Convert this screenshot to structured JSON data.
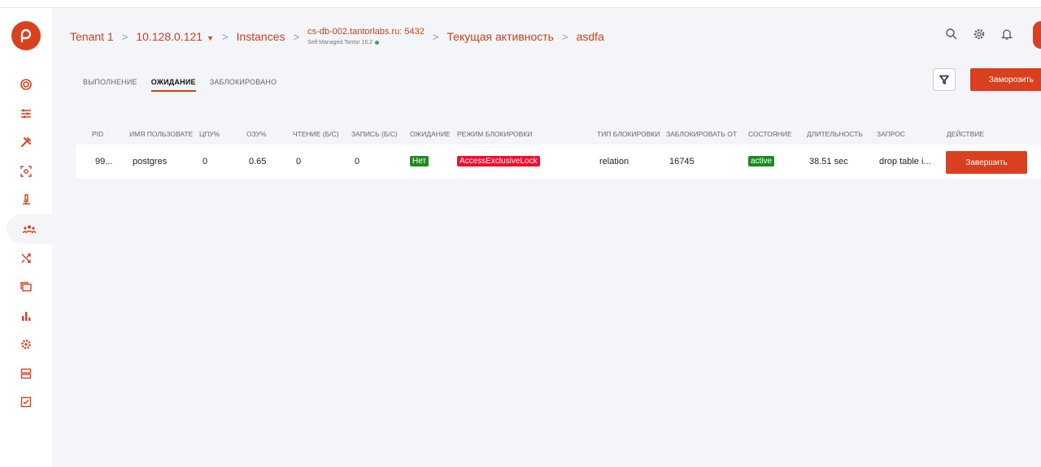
{
  "colors": {
    "accent": "#d9401f",
    "success": "#1e8a1e",
    "danger": "#f20d2a"
  },
  "breadcrumbs": {
    "tenant": "Tenant 1",
    "host": "10.128.0.121",
    "instances": "Instances",
    "db": "cs-db-002.tantorlabs.ru: 5432",
    "db_sub": "Self Managed Tantor 16.2",
    "activity": "Текущая активность",
    "current": "asdfa"
  },
  "header_icons": [
    "search-icon",
    "gear-icon",
    "bell-icon"
  ],
  "sidebar_icons": [
    "target-icon",
    "sliders-icon",
    "tools-icon",
    "scan-icon",
    "microscope-icon",
    "users-icon",
    "shuffle-icon",
    "folders-icon",
    "bar-chart-icon",
    "cog-icon",
    "server-icon",
    "checklist-icon"
  ],
  "tabs": [
    {
      "label": "ВЫПОЛНЕНИЕ",
      "active": false
    },
    {
      "label": "ОЖИДАНИЕ",
      "active": true
    },
    {
      "label": "ЗАБЛОКИРОВАНО",
      "active": false
    }
  ],
  "freeze_label": "Заморозить",
  "table": {
    "headers": [
      "PID",
      "ИМЯ ПОЛЬЗОВАТЕЛЯ",
      "ЦПУ%",
      "ОЗУ%",
      "ЧТЕНИЕ (Б/С)",
      "ЗАПИСЬ (Б/С)",
      "ОЖИДАНИЕ",
      "РЕЖИМ БЛОКИРОВКИ",
      "ТИП БЛОКИРОВКИ",
      "ЗАБЛОКИРОВАТЬ ОТ",
      "СОСТОЯНИЕ",
      "ДЛИТЕЛЬНОСТЬ",
      "ЗАПРОС",
      "ДЕЙСТВИЕ"
    ],
    "row": {
      "pid": "99...",
      "user": "postgres",
      "cpu": "0",
      "ram": "0.65",
      "read": "0",
      "write": "0",
      "waiting": "Нет",
      "lock_mode": "AccessExclusiveLock",
      "lock_type": "relation",
      "blocked_by": "16745",
      "state": "active",
      "duration": "38.51 sec",
      "query": "drop table i...",
      "action": "Завершить"
    }
  }
}
